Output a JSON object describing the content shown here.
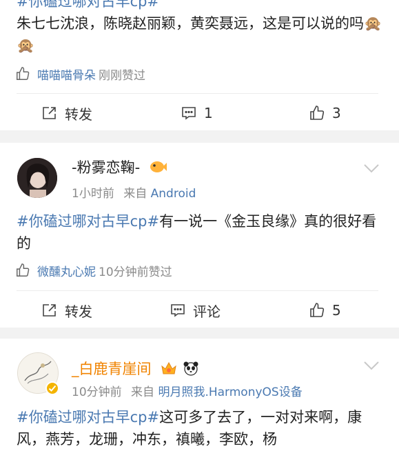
{
  "post1": {
    "topic_cut": "#你磕过哪对古早cp#",
    "text": "朱七七沈浪，陈晓赵丽颖，黄奕聂远，这是可以说的吗🙊🙊",
    "liked_by": "喵喵喵骨朵",
    "liked_meta": "刚刚赞过",
    "repost_label": "转发",
    "comment_count": "1",
    "like_count": "3"
  },
  "post2": {
    "username": "-粉雾恋鞠-",
    "time": "1小时前",
    "from_label": "来自",
    "source": "Android",
    "topic": "#你磕过哪对古早cp#",
    "text": "有一说一《金玉良缘》真的很好看的",
    "liked_by": "微醺丸心妮",
    "liked_meta": "10分钟前赞过",
    "repost_label": "转发",
    "comment_label": "评论",
    "like_count": "5"
  },
  "post3": {
    "username": "_白鹿青崖间",
    "time": "10分钟前",
    "from_label": "来自",
    "source": "明月照我.HarmonyOS设备",
    "topic": "#你磕过哪对古早cp#",
    "text": "这可多了去了，一对对来啊，康风，燕芳，龙珊，冲东，禛曦，李欧，杨"
  },
  "colors": {
    "link": "#4a79b1",
    "vip_orange": "#f08300",
    "background": "#f2f2f2"
  }
}
